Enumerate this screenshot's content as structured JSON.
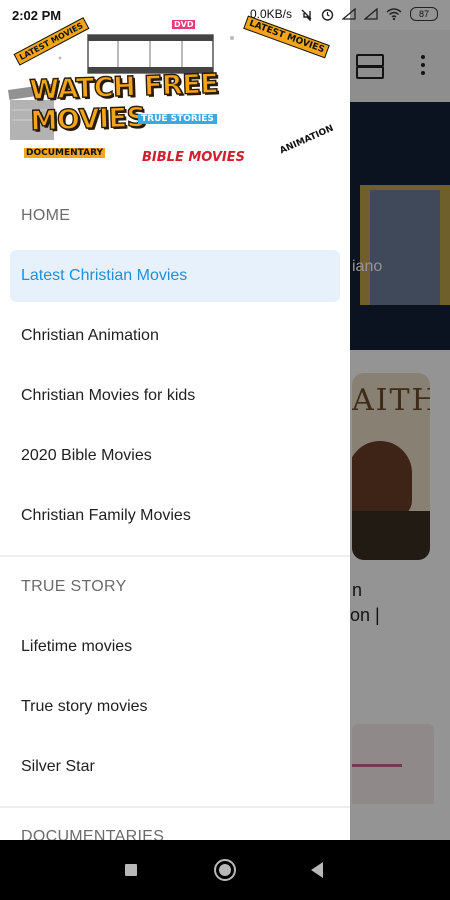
{
  "status_bar": {
    "time": "2:02 PM",
    "network_speed": "0.0KB/s",
    "battery": "87"
  },
  "background": {
    "hero_text": "iano",
    "card_title": "AITH",
    "line1": "n",
    "line2": "on |"
  },
  "drawer": {
    "logo": {
      "title": "WATCH FREE MOVIES",
      "tag_latest_left": "LATEST MOVIES",
      "tag_latest_right": "LATEST MOVIES",
      "tag_dvd": "DVD",
      "tag_true_stories": "TRUE STORIES",
      "tag_documentary": "DOCUMENTARY",
      "tag_bible": "BIBLE MOVIES",
      "tag_animation": "ANIMATION"
    },
    "sections": [
      {
        "label": "HOME",
        "items": [
          {
            "label": "Latest Christian Movies",
            "active": true
          },
          {
            "label": "Christian Animation"
          },
          {
            "label": "Christian Movies for kids"
          },
          {
            "label": "2020 Bible Movies"
          },
          {
            "label": "Christian Family Movies"
          }
        ]
      },
      {
        "label": "TRUE STORY",
        "items": [
          {
            "label": "Lifetime movies"
          },
          {
            "label": "True story movies"
          },
          {
            "label": "Silver Star"
          }
        ]
      },
      {
        "label": "DOCUMENTARIES",
        "items": []
      }
    ]
  },
  "colors": {
    "accent": "#1f8fde",
    "active_item_bg": "#e6f1fb",
    "logo_orange": "#f2a51a"
  },
  "icons": {
    "toolbar": [
      "view-toggle-icon",
      "more-vert-icon"
    ],
    "status": [
      "mute-icon",
      "alarm-icon",
      "signal-icon",
      "wifi-icon",
      "battery-icon"
    ],
    "nav": [
      "recents-icon",
      "home-icon",
      "back-icon"
    ]
  }
}
